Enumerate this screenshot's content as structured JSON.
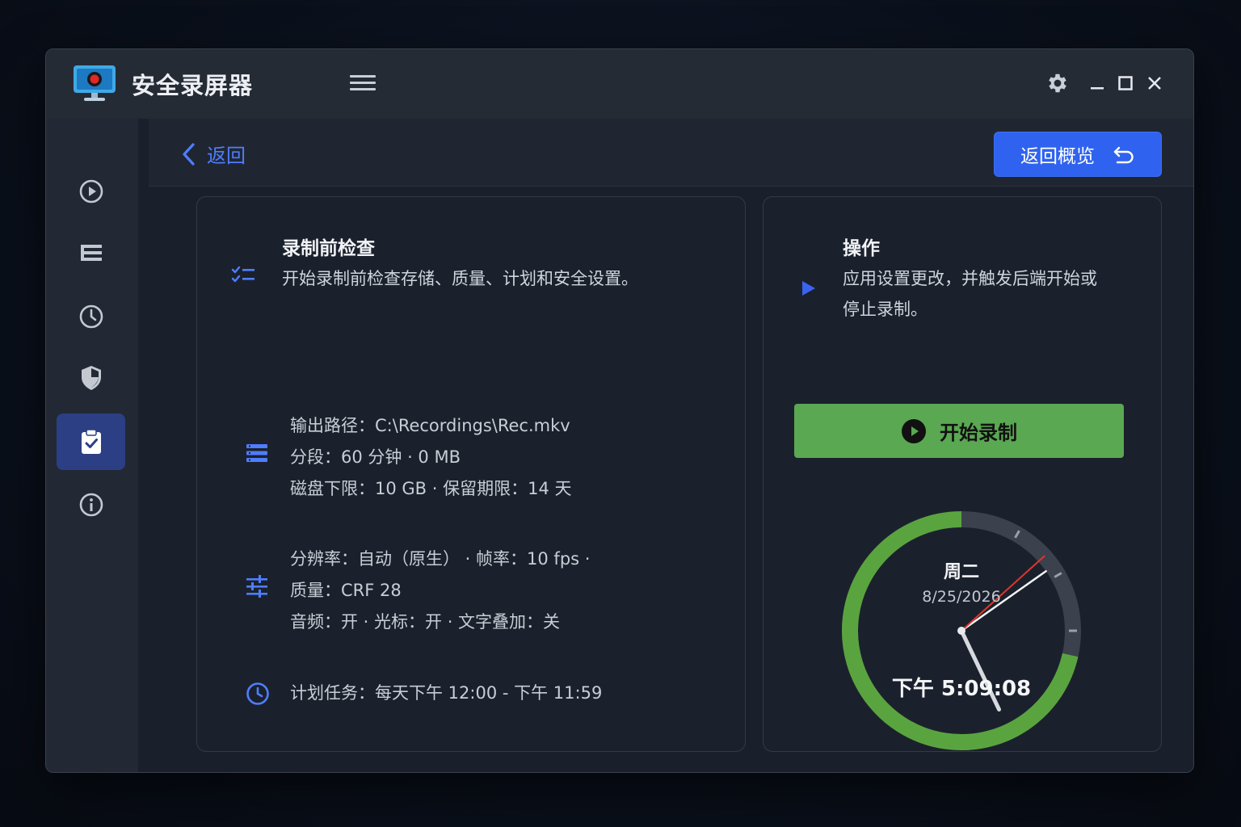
{
  "app": {
    "title": "安全录屏器"
  },
  "topbar": {
    "back_label": "返回",
    "overview_label": "返回概览"
  },
  "check_card": {
    "title": "录制前检查",
    "description": "开始录制前检查存储、质量、计划和安全设置。",
    "storage": {
      "line1": "输出路径：C:\\Recordings\\Rec.mkv",
      "line2": "分段：60 分钟 · 0 MB",
      "line3": "磁盘下限：10 GB · 保留期限：14 天"
    },
    "quality": {
      "line1": "分辨率：自动（原生） · 帧率：10 fps ·",
      "line2": "质量：CRF 28",
      "line3": "音频：开 · 光标：开 · 文字叠加：关"
    },
    "schedule": {
      "line1": "计划任务：每天下午 12:00 - 下午 11:59"
    }
  },
  "action_card": {
    "title": "操作",
    "description_line1": "应用设置更改，并触发后端开始或",
    "description_line2": "停止录制。",
    "start_label": "开始录制"
  },
  "clock": {
    "day": "周二",
    "date": "8/25/2026",
    "time": "下午 5:09:08",
    "day_progress": 0.715
  },
  "colors": {
    "accent": "#2f63ef",
    "link": "#4f7dff",
    "start_green": "#5aa852",
    "progress_green": "#5aa43f",
    "second_hand": "#e0362b",
    "active_nav": "#2c3f84"
  },
  "sidebar": {
    "items": [
      {
        "icon": "play-circle-icon"
      },
      {
        "icon": "list-icon"
      },
      {
        "icon": "clock-icon"
      },
      {
        "icon": "shield-icon"
      },
      {
        "icon": "clipboard-check-icon",
        "active": true
      },
      {
        "icon": "info-icon"
      }
    ]
  }
}
